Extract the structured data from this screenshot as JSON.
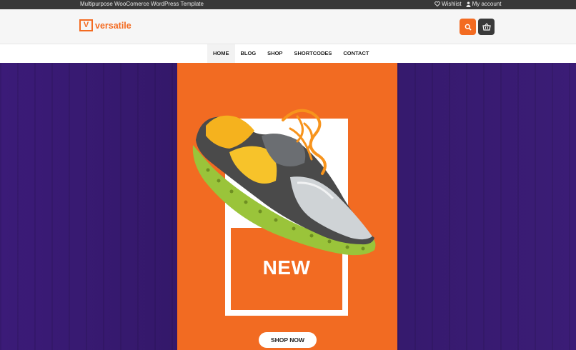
{
  "topbar": {
    "tagline": "Multipurpose WooComerce WordPress Template",
    "wishlist": "Wishlist",
    "account": "My account"
  },
  "header": {
    "logo_letter": "V",
    "logo_text": "versatile",
    "accent_color": "#f36b21"
  },
  "nav": {
    "items": [
      "HOME",
      "BLOG",
      "SHOP",
      "SHORTCODES",
      "CONTACT"
    ],
    "active": "HOME"
  },
  "hero": {
    "badge_text": "NEW",
    "cta_label": "SHOP NOW",
    "background_color": "#3a1c72",
    "panel_color": "#f26b22"
  },
  "icons": {
    "heart": "heart-icon",
    "user": "user-icon",
    "search": "search-icon",
    "cart": "basket-icon"
  }
}
